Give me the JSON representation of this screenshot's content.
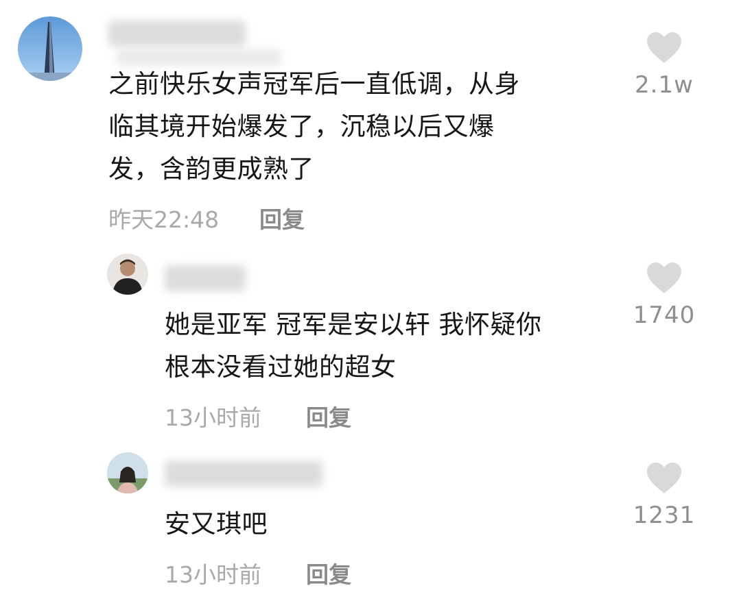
{
  "comments": [
    {
      "text": "之前快乐女声冠军后一直低调，从身\n临其境开始爆发了，沉稳以后又爆\n发，含韵更成熟了",
      "time": "昨天22:48",
      "reply_label": "回复",
      "likes": "2.1w",
      "avatar_icon": "skyscraper-avatar-icon"
    },
    {
      "text": "她是亚军 冠军是安以轩 我怀疑你\n根本没看过她的超女",
      "time": "13小时前",
      "reply_label": "回复",
      "likes": "1740",
      "avatar_icon": "man-portrait-avatar-icon"
    },
    {
      "text": "安又琪吧",
      "time": "13小时前",
      "reply_label": "回复",
      "likes": "1231",
      "avatar_icon": "woman-outdoor-avatar-icon"
    }
  ],
  "colors": {
    "text": "#161616",
    "meta": "#a9a9a9",
    "reply": "#8a8a8a",
    "heart": "#d9d9d9"
  }
}
